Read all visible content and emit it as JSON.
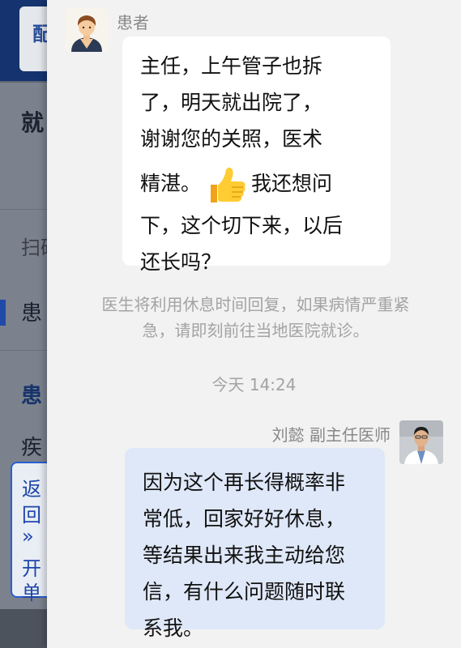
{
  "underlay": {
    "top_card_text": "配",
    "heading": "就",
    "scan_text": "扫码",
    "patient_label": "患",
    "patient_label_bold": "患",
    "disease_label": "疾",
    "return_button": {
      "line1": "返",
      "line2": "回",
      "arrows": "»",
      "line3": "开",
      "line4": "单"
    }
  },
  "chat": {
    "messages": [
      {
        "sender": "患者",
        "direction": "incoming",
        "lines": [
          "主任，上午管子也拆",
          "了，明天就出院了，",
          "谢谢您的关照，医术",
          "精湛。",
          "我还想问",
          "下，这个切下来，以后",
          "还长吗？"
        ],
        "emoji": "thumbs-up"
      },
      {
        "sender": "刘懿 副主任医师",
        "direction": "outgoing",
        "lines": [
          "因为这个再长得概率非",
          "常低，回家好好休息，",
          "等结果出来我主动给您",
          "信，有什么问题随时联",
          "系我。"
        ]
      }
    ],
    "system_notice": {
      "line1": "医生将利用休息时间回复，如果病情严重紧",
      "line2": "急，请即刻前往当地医院就诊。"
    },
    "timestamp": "今天 14:24"
  },
  "colors": {
    "background": "#f2f2f2",
    "incoming_bubble": "#ffffff",
    "outgoing_bubble": "#dfe8f8",
    "meta_text": "#a3a3a3",
    "sender_text": "#888888",
    "underlay_blue": "#15336e",
    "return_border": "#2a5fd0"
  },
  "icons": {
    "patient_avatar": "patient-avatar-icon",
    "doctor_avatar": "doctor-avatar-icon",
    "thumbs_up": "thumbs-up-icon",
    "return_arrows": "double-chevron-right-icon"
  }
}
